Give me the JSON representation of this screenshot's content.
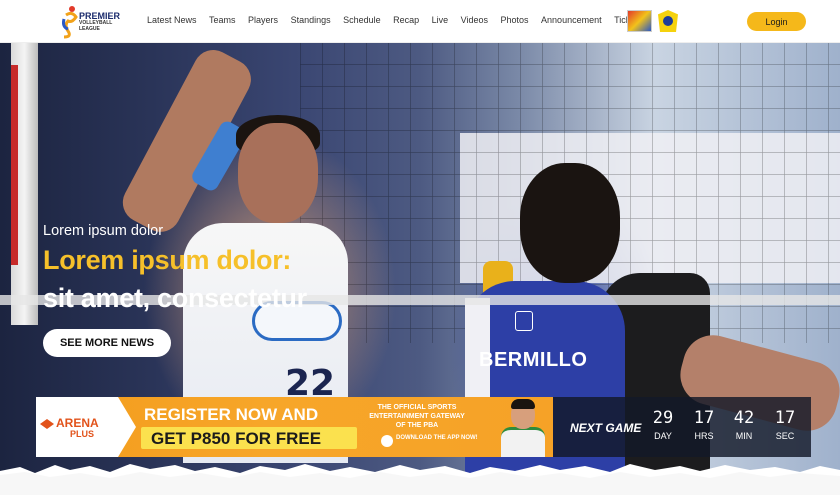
{
  "nav": {
    "logo_text": "PREMIER",
    "logo_sub": "VOLLEYBALL LEAGUE",
    "items": [
      "Latest News",
      "Teams",
      "Players",
      "Standings",
      "Schedule",
      "Recap",
      "Live",
      "Videos",
      "Photos",
      "Announcement",
      "Tickets"
    ],
    "login_label": "Login"
  },
  "hero": {
    "subtitle": "Lorem ipsum dolor",
    "title_line1": "Lorem ipsum dolor:",
    "title_line2": "sit amet, consectetur",
    "cta_label": "SEE MORE NEWS",
    "jersey_name": "BERMILLO",
    "jersey_number": "22"
  },
  "ad": {
    "brand": "ARENA",
    "brand_sub": "PLUS",
    "line1": "REGISTER NOW AND",
    "line2": "GET P850 FOR FREE",
    "gateway": "THE OFFICIAL SPORTS ENTERTAINMENT GATEWAY OF THE PBA",
    "download": "DOWNLOAD THE APP NOW!"
  },
  "countdown": {
    "label": "NEXT GAME",
    "days": "29",
    "days_label": "DAY",
    "hours": "17",
    "hours_label": "HRS",
    "mins": "42",
    "mins_label": "MIN",
    "secs": "17",
    "secs_label": "SEC"
  },
  "colors": {
    "accent_yellow": "#f6c02a",
    "login_bg": "#f5b81a",
    "ad_orange": "#f39c1c"
  }
}
